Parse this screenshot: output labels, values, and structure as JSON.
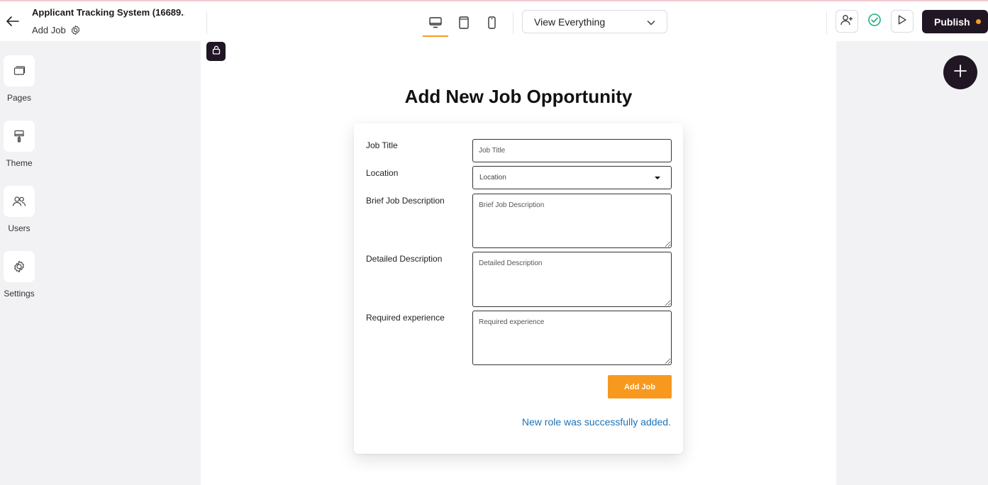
{
  "header": {
    "app_title": "Applicant Tracking System (16689...",
    "page_name": "Add Job",
    "view_select": "View Everything",
    "publish_label": "Publish"
  },
  "sidebar": {
    "items": [
      {
        "label": "Pages",
        "icon": "pages-icon"
      },
      {
        "label": "Theme",
        "icon": "paint-roller-icon"
      },
      {
        "label": "Users",
        "icon": "users-icon"
      },
      {
        "label": "Settings",
        "icon": "gear-icon"
      }
    ]
  },
  "form": {
    "title": "Add New Job Opportunity",
    "fields": [
      {
        "label": "Job Title",
        "placeholder": "Job Title"
      },
      {
        "label": "Location",
        "placeholder": "Location"
      },
      {
        "label": "Brief Job Description",
        "placeholder": "Brief Job Description"
      },
      {
        "label": "Detailed Description",
        "placeholder": "Detailed Description"
      },
      {
        "label": "Required experience",
        "placeholder": "Required experience"
      }
    ],
    "submit_label": "Add Job",
    "success_message": "New role was successfully added."
  },
  "colors": {
    "accent": "#f7991f",
    "dark": "#211623",
    "success_text": "#1a73b8",
    "check_green": "#1fb07a"
  }
}
